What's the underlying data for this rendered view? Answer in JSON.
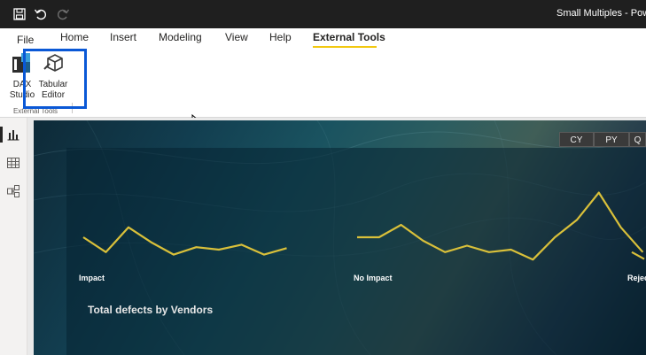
{
  "window": {
    "title": "Small Multiples - Power"
  },
  "menu": {
    "tabs": [
      {
        "label": "File",
        "active": false
      },
      {
        "label": "Home",
        "active": false
      },
      {
        "label": "Insert",
        "active": false
      },
      {
        "label": "Modeling",
        "active": false
      },
      {
        "label": "View",
        "active": false
      },
      {
        "label": "Help",
        "active": false
      },
      {
        "label": "External Tools",
        "active": true
      }
    ]
  },
  "ribbon": {
    "tools": [
      {
        "line1": "DAX",
        "line2": "Studio",
        "icon": "dax-studio-icon"
      },
      {
        "line1": "Tabular",
        "line2": "Editor",
        "icon": "tabular-editor-icon"
      }
    ],
    "group_label": "External Tools"
  },
  "report": {
    "period_buttons": [
      "CY",
      "PY",
      "Q"
    ],
    "multiples": [
      {
        "label": "Impact",
        "values": [
          5,
          2,
          7,
          4,
          1.5,
          3,
          2.5,
          3.5,
          1.5,
          2.8
        ]
      },
      {
        "label": "No Impact",
        "values": [
          5,
          5,
          7.5,
          4.3,
          2,
          3.3,
          2,
          2.5,
          0.5,
          5,
          8.5,
          14,
          7,
          2
        ]
      },
      {
        "label": "Rejec",
        "values": [
          2,
          0.6
        ]
      }
    ],
    "line_color": "#d9c03a",
    "visual_title": "Total defects by Vendors"
  },
  "theme": {
    "accent": "#f2c811",
    "highlight": "#0a58d6"
  }
}
